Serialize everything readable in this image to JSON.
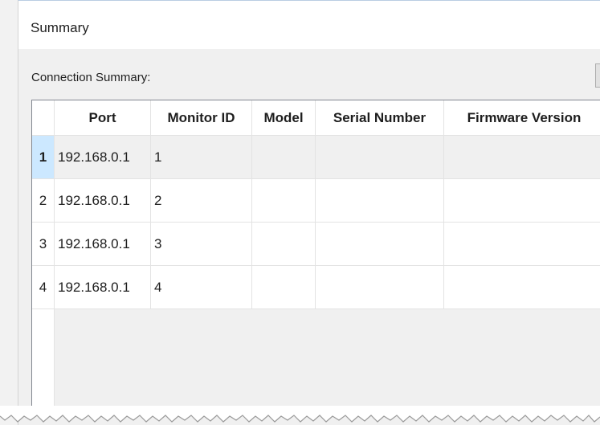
{
  "window": {
    "title": "Summary"
  },
  "section": {
    "label": "Connection Summary:"
  },
  "table": {
    "columns": [
      "Port",
      "Monitor ID",
      "Model",
      "Serial Number",
      "Firmware Version"
    ],
    "rows": [
      {
        "num": "1",
        "cells": [
          "192.168.0.1",
          "1",
          "",
          "",
          ""
        ]
      },
      {
        "num": "2",
        "cells": [
          "192.168.0.1",
          "2",
          "",
          "",
          ""
        ]
      },
      {
        "num": "3",
        "cells": [
          "192.168.0.1",
          "3",
          "",
          "",
          ""
        ]
      },
      {
        "num": "4",
        "cells": [
          "192.168.0.1",
          "4",
          "",
          "",
          ""
        ]
      }
    ],
    "selected_row": "1"
  },
  "colors": {
    "selection": "#cce8ff",
    "grid_line": "#e3e3e3",
    "border": "#828790"
  }
}
